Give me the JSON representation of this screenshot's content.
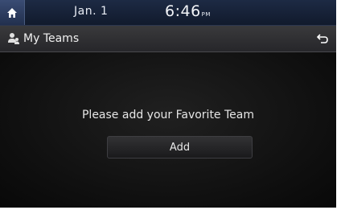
{
  "status_bar": {
    "home_icon": "home-icon",
    "date": "Jan.  1",
    "time": "6:46",
    "ampm": "PM"
  },
  "title_bar": {
    "icon": "team-icon",
    "title": "My Teams",
    "back_icon": "back-icon"
  },
  "main": {
    "message": "Please add your Favorite Team",
    "add_label": "Add"
  },
  "colors": {
    "status_bar_bg": "#1d2a44",
    "title_bar_bg": "#333335",
    "main_bg": "#101010",
    "text": "#e6e6e6"
  }
}
